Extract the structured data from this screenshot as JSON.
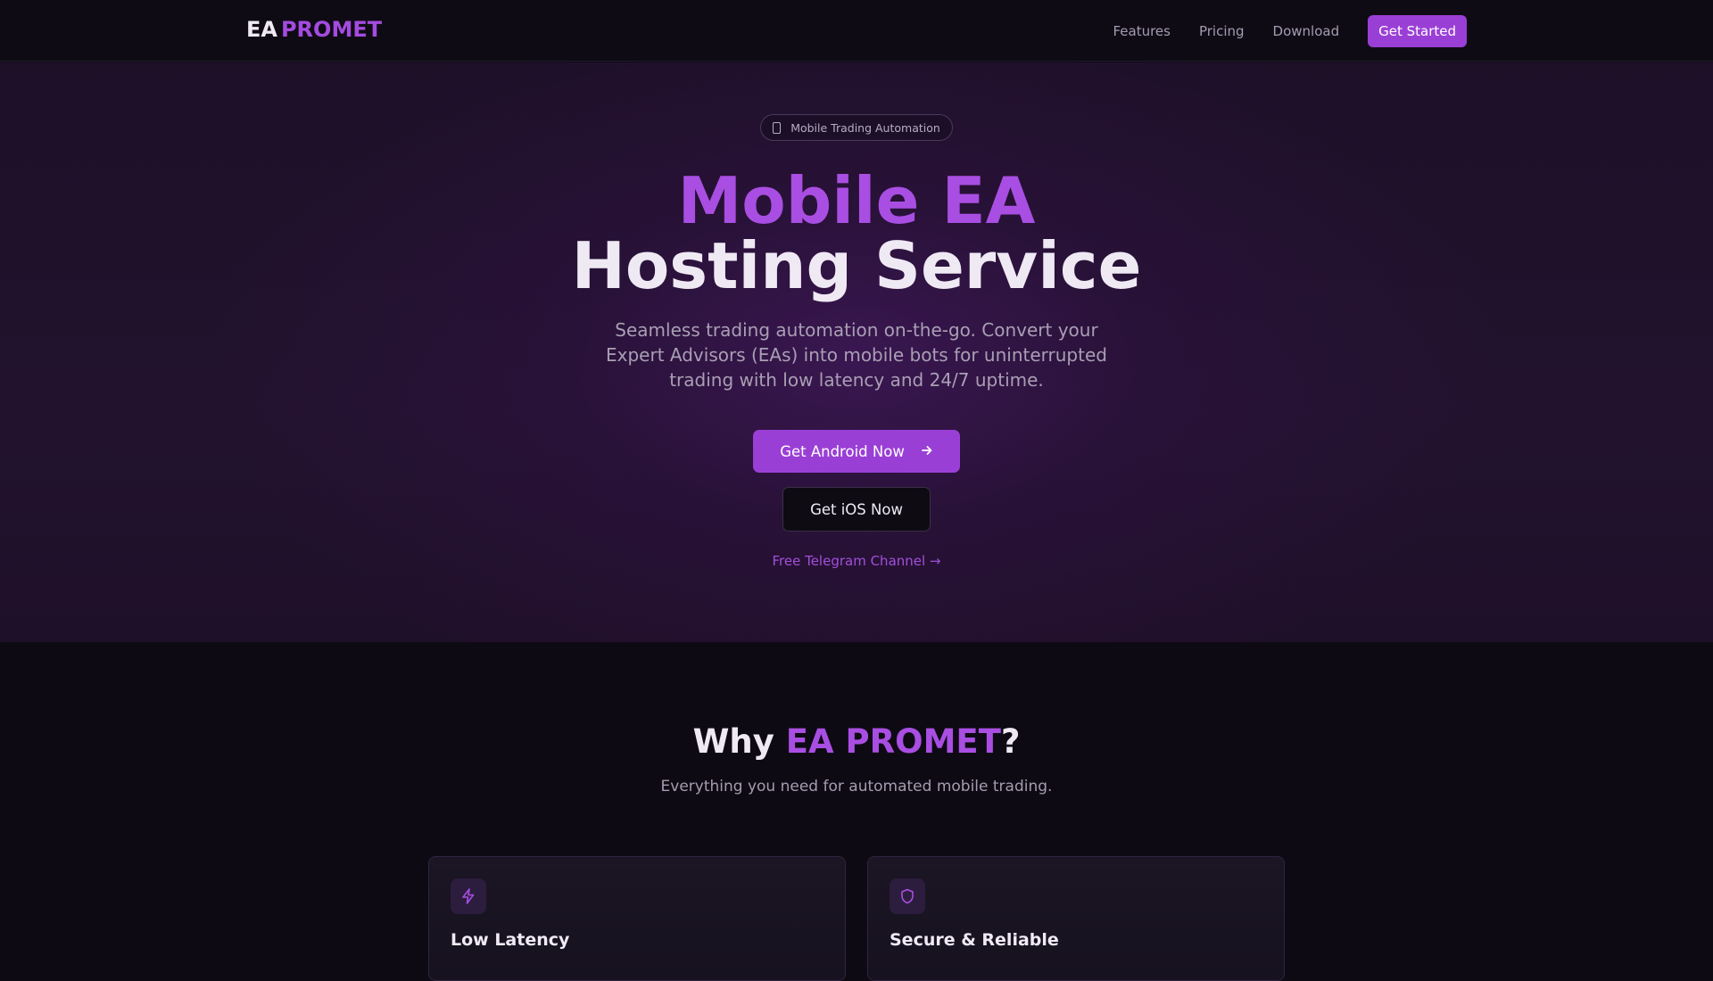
{
  "header": {
    "logo_part1": "EA",
    "logo_part2": "PROMET",
    "nav": [
      "Features",
      "Pricing",
      "Download"
    ],
    "cta": "Get Started"
  },
  "hero": {
    "badge": "Mobile Trading Automation",
    "badge_icon": "smartphone-icon",
    "title_line1": "Mobile EA",
    "title_line2": "Hosting Service",
    "subtitle": "Seamless trading automation on-the-go. Convert your Expert Advisors (EAs) into mobile bots for uninterrupted trading with low latency and 24/7 uptime.",
    "android_button": "Get Android Now",
    "android_icon": "arrow-right-icon",
    "ios_button": "Get iOS Now",
    "telegram_link": "Free Telegram Channel →"
  },
  "features": {
    "heading_prefix": "Why ",
    "heading_accent": "EA PROMET",
    "heading_suffix": "?",
    "subheading": "Everything you need for automated mobile trading.",
    "cards": [
      {
        "title": "Low Latency",
        "icon": "lightning-icon"
      },
      {
        "title": "Secure & Reliable",
        "icon": "shield-icon"
      }
    ]
  },
  "colors": {
    "accent": "#9a3fd6",
    "accent_text": "#a94ee2",
    "background": "#0e0a14"
  }
}
